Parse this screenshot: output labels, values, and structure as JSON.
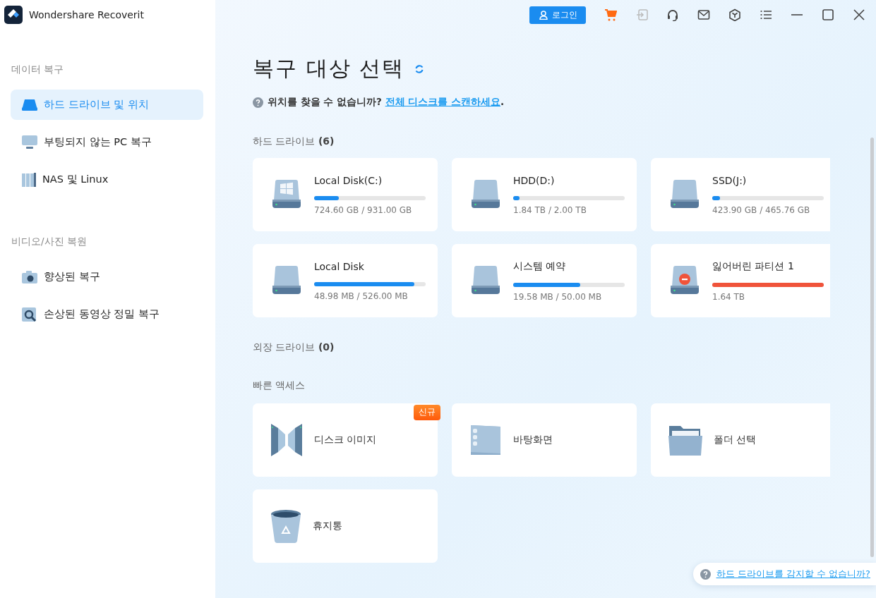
{
  "app": {
    "title": "Wondershare Recoverit"
  },
  "topbar": {
    "login_button": "로그인"
  },
  "sidebar": {
    "sections": [
      {
        "heading": "데이터 복구",
        "items": [
          {
            "label": "하드 드라이브 및 위치",
            "kind": "drive",
            "selected": true
          },
          {
            "label": "부팅되지 않는 PC 복구",
            "kind": "monitor",
            "selected": false
          },
          {
            "label": "NAS 및 Linux",
            "kind": "nas",
            "selected": false
          }
        ]
      },
      {
        "heading": "비디오/사진 복원",
        "items": [
          {
            "label": "향상된 복구",
            "kind": "camera",
            "selected": false
          },
          {
            "label": "손상된 동영상 정밀 복구",
            "kind": "repair",
            "selected": false
          }
        ]
      }
    ]
  },
  "main": {
    "title": "복구 대상 선택",
    "hint": {
      "text": "위치를 찾을 수 없습니까?",
      "link": "전체 디스크를 스캔하세요",
      "suffix": "."
    },
    "hard_drives": {
      "heading": "하드 드라이브 **(6)**",
      "drives": [
        {
          "name": "Local Disk(C:)",
          "kind": "system",
          "level": 0.22,
          "usage": "724.60 GB / 931.00 GB"
        },
        {
          "name": "HDD(D:)",
          "kind": "disk",
          "level": 0.06,
          "usage": "1.84 TB / 2.00 TB"
        },
        {
          "name": "SSD(J:)",
          "kind": "disk",
          "level": 0.07,
          "usage": "423.90 GB / 465.76 GB"
        },
        {
          "name": "Local Disk",
          "kind": "disk",
          "level": 0.9,
          "usage": "48.98 MB / 526.00 MB"
        },
        {
          "name": "시스템 예약",
          "kind": "disk",
          "level": 0.6,
          "usage": "19.58 MB / 50.00 MB"
        },
        {
          "name": "잃어버린 파티션 1",
          "kind": "lost",
          "level": 1,
          "usage": "1.64 TB"
        }
      ]
    },
    "external_drives": {
      "heading": "외장 드라이브 **(0)**"
    },
    "quick_access": {
      "heading": "빠른 액세스",
      "items": [
        {
          "label": "디스크 이미지",
          "kind": "disk-image",
          "badge": "신규"
        },
        {
          "label": "바탕화면",
          "kind": "desktop"
        },
        {
          "label": "폴더 선택",
          "kind": "folder"
        },
        {
          "label": "휴지통",
          "kind": "trash"
        }
      ]
    },
    "help_link": "하드 드라이브를 감지할 수 없습니까?"
  }
}
